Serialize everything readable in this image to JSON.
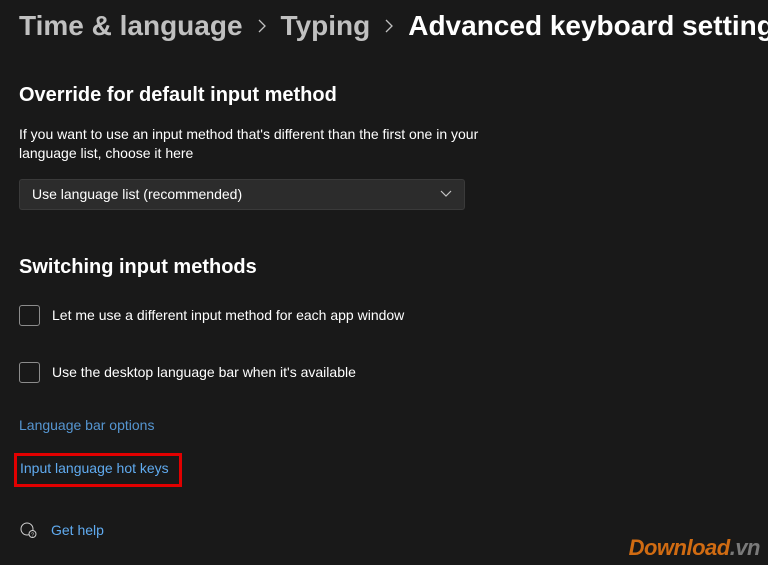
{
  "breadcrumb": {
    "items": [
      "Time & language",
      "Typing",
      "Advanced keyboard settings"
    ]
  },
  "override": {
    "heading": "Override for default input method",
    "desc": "If you want to use an input method that's different than the first one in your language list, choose it here",
    "dropdown_value": "Use language list (recommended)"
  },
  "switching": {
    "heading": "Switching input methods",
    "checkbox1": "Let me use a different input method for each app window",
    "checkbox2": "Use the desktop language bar when it's available",
    "link_lang_bar": "Language bar options",
    "link_hotkeys": "Input language hot keys"
  },
  "gethelp": "Get help",
  "watermark": {
    "a": "Download",
    "b": ".vn"
  }
}
